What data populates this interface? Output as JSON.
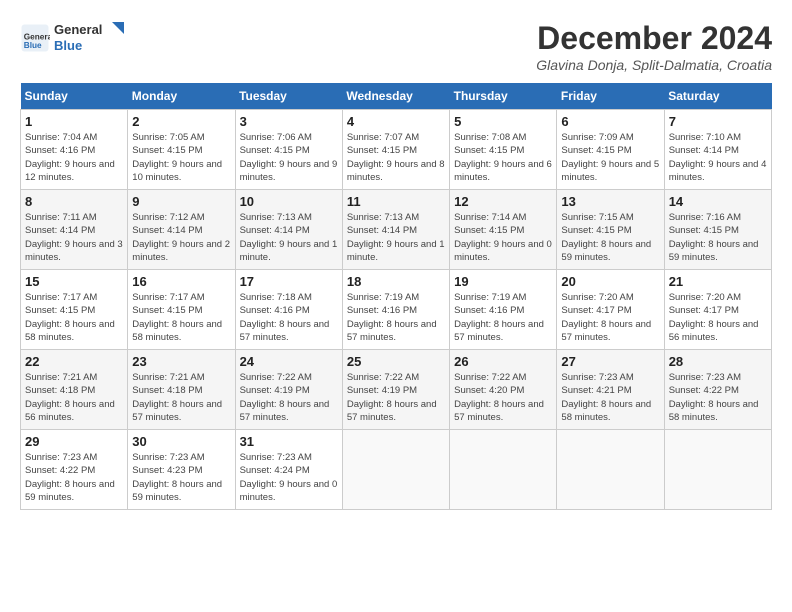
{
  "header": {
    "logo": {
      "general": "General",
      "blue": "Blue"
    },
    "title": "December 2024",
    "location": "Glavina Donja, Split-Dalmatia, Croatia"
  },
  "days_of_week": [
    "Sunday",
    "Monday",
    "Tuesday",
    "Wednesday",
    "Thursday",
    "Friday",
    "Saturday"
  ],
  "weeks": [
    [
      {
        "day": "1",
        "sunrise": "7:04 AM",
        "sunset": "4:16 PM",
        "daylight": "9 hours and 12 minutes."
      },
      {
        "day": "2",
        "sunrise": "7:05 AM",
        "sunset": "4:15 PM",
        "daylight": "9 hours and 10 minutes."
      },
      {
        "day": "3",
        "sunrise": "7:06 AM",
        "sunset": "4:15 PM",
        "daylight": "9 hours and 9 minutes."
      },
      {
        "day": "4",
        "sunrise": "7:07 AM",
        "sunset": "4:15 PM",
        "daylight": "9 hours and 8 minutes."
      },
      {
        "day": "5",
        "sunrise": "7:08 AM",
        "sunset": "4:15 PM",
        "daylight": "9 hours and 6 minutes."
      },
      {
        "day": "6",
        "sunrise": "7:09 AM",
        "sunset": "4:15 PM",
        "daylight": "9 hours and 5 minutes."
      },
      {
        "day": "7",
        "sunrise": "7:10 AM",
        "sunset": "4:14 PM",
        "daylight": "9 hours and 4 minutes."
      }
    ],
    [
      {
        "day": "8",
        "sunrise": "7:11 AM",
        "sunset": "4:14 PM",
        "daylight": "9 hours and 3 minutes."
      },
      {
        "day": "9",
        "sunrise": "7:12 AM",
        "sunset": "4:14 PM",
        "daylight": "9 hours and 2 minutes."
      },
      {
        "day": "10",
        "sunrise": "7:13 AM",
        "sunset": "4:14 PM",
        "daylight": "9 hours and 1 minute."
      },
      {
        "day": "11",
        "sunrise": "7:13 AM",
        "sunset": "4:14 PM",
        "daylight": "9 hours and 1 minute."
      },
      {
        "day": "12",
        "sunrise": "7:14 AM",
        "sunset": "4:15 PM",
        "daylight": "9 hours and 0 minutes."
      },
      {
        "day": "13",
        "sunrise": "7:15 AM",
        "sunset": "4:15 PM",
        "daylight": "8 hours and 59 minutes."
      },
      {
        "day": "14",
        "sunrise": "7:16 AM",
        "sunset": "4:15 PM",
        "daylight": "8 hours and 59 minutes."
      }
    ],
    [
      {
        "day": "15",
        "sunrise": "7:17 AM",
        "sunset": "4:15 PM",
        "daylight": "8 hours and 58 minutes."
      },
      {
        "day": "16",
        "sunrise": "7:17 AM",
        "sunset": "4:15 PM",
        "daylight": "8 hours and 58 minutes."
      },
      {
        "day": "17",
        "sunrise": "7:18 AM",
        "sunset": "4:16 PM",
        "daylight": "8 hours and 57 minutes."
      },
      {
        "day": "18",
        "sunrise": "7:19 AM",
        "sunset": "4:16 PM",
        "daylight": "8 hours and 57 minutes."
      },
      {
        "day": "19",
        "sunrise": "7:19 AM",
        "sunset": "4:16 PM",
        "daylight": "8 hours and 57 minutes."
      },
      {
        "day": "20",
        "sunrise": "7:20 AM",
        "sunset": "4:17 PM",
        "daylight": "8 hours and 57 minutes."
      },
      {
        "day": "21",
        "sunrise": "7:20 AM",
        "sunset": "4:17 PM",
        "daylight": "8 hours and 56 minutes."
      }
    ],
    [
      {
        "day": "22",
        "sunrise": "7:21 AM",
        "sunset": "4:18 PM",
        "daylight": "8 hours and 56 minutes."
      },
      {
        "day": "23",
        "sunrise": "7:21 AM",
        "sunset": "4:18 PM",
        "daylight": "8 hours and 57 minutes."
      },
      {
        "day": "24",
        "sunrise": "7:22 AM",
        "sunset": "4:19 PM",
        "daylight": "8 hours and 57 minutes."
      },
      {
        "day": "25",
        "sunrise": "7:22 AM",
        "sunset": "4:19 PM",
        "daylight": "8 hours and 57 minutes."
      },
      {
        "day": "26",
        "sunrise": "7:22 AM",
        "sunset": "4:20 PM",
        "daylight": "8 hours and 57 minutes."
      },
      {
        "day": "27",
        "sunrise": "7:23 AM",
        "sunset": "4:21 PM",
        "daylight": "8 hours and 58 minutes."
      },
      {
        "day": "28",
        "sunrise": "7:23 AM",
        "sunset": "4:22 PM",
        "daylight": "8 hours and 58 minutes."
      }
    ],
    [
      {
        "day": "29",
        "sunrise": "7:23 AM",
        "sunset": "4:22 PM",
        "daylight": "8 hours and 59 minutes."
      },
      {
        "day": "30",
        "sunrise": "7:23 AM",
        "sunset": "4:23 PM",
        "daylight": "8 hours and 59 minutes."
      },
      {
        "day": "31",
        "sunrise": "7:23 AM",
        "sunset": "4:24 PM",
        "daylight": "9 hours and 0 minutes."
      },
      null,
      null,
      null,
      null
    ]
  ]
}
